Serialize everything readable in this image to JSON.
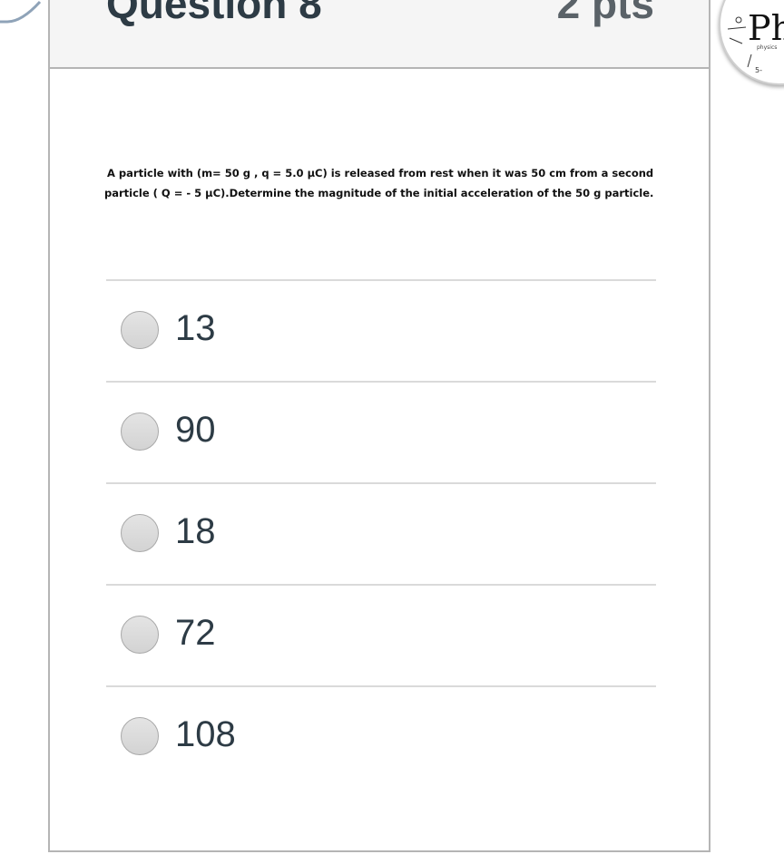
{
  "question": {
    "title": "Question 8",
    "points": "2 pts",
    "text": "A particle with (m= 50 g , q = 5.0 μC) is released from rest when it was 50 cm from a second particle ( Q = - 5 μC).Determine the magnitude of the initial acceleration of the 50 g particle."
  },
  "answers": [
    {
      "label": "13",
      "selected": false
    },
    {
      "label": "90",
      "selected": false
    },
    {
      "label": "18",
      "selected": false
    },
    {
      "label": "72",
      "selected": false
    },
    {
      "label": "108",
      "selected": false
    }
  ],
  "colors": {
    "header_bg": "#f5f5f5",
    "border": "#b5b5b5",
    "text_dark": "#2d3b45",
    "points_gray": "#5a6268",
    "divider": "#dadada"
  }
}
